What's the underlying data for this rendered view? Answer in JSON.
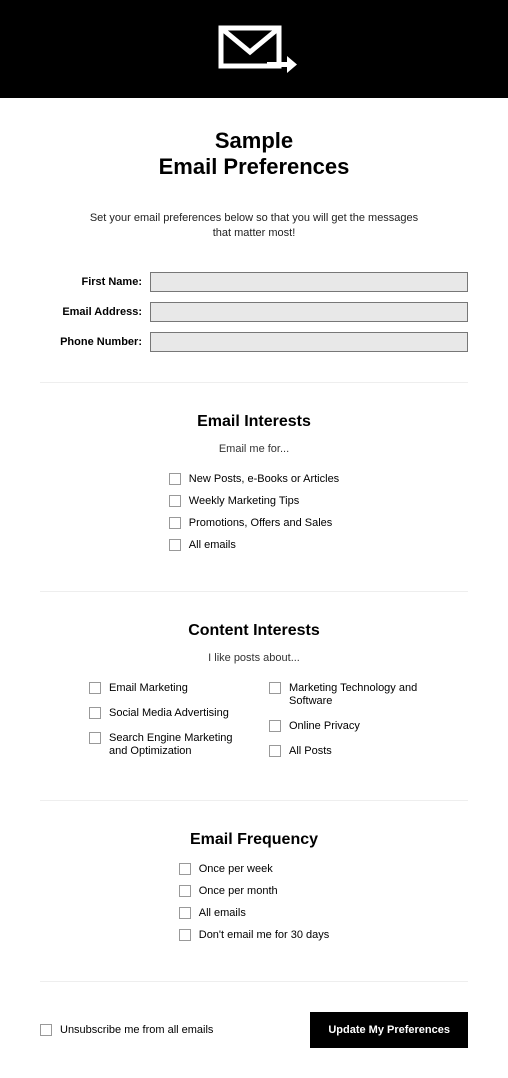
{
  "title_line1": "Sample",
  "title_line2": "Email Preferences",
  "subtitle": "Set your email preferences below so that you will get the messages that matter most!",
  "fields": {
    "first_name": {
      "label": "First Name:",
      "value": ""
    },
    "email": {
      "label": "Email Address:",
      "value": ""
    },
    "phone": {
      "label": "Phone Number:",
      "value": ""
    }
  },
  "interests": {
    "heading": "Email Interests",
    "sub": "Email me for...",
    "options": [
      "New Posts, e-Books or Articles",
      "Weekly Marketing Tips",
      "Promotions, Offers and Sales",
      "All emails"
    ]
  },
  "content": {
    "heading": "Content Interests",
    "sub": "I like posts about...",
    "col1": [
      "Email Marketing",
      "Social Media Advertising",
      "Search Engine Marketing and Optimization"
    ],
    "col2": [
      "Marketing Technology and Software",
      "Online Privacy",
      "All Posts"
    ]
  },
  "frequency": {
    "heading": "Email Frequency",
    "options": [
      "Once per week",
      "Once per month",
      "All emails",
      "Don't email me for 30 days"
    ]
  },
  "unsubscribe_label": "Unsubscribe me from all emails",
  "submit_label": "Update My Preferences"
}
